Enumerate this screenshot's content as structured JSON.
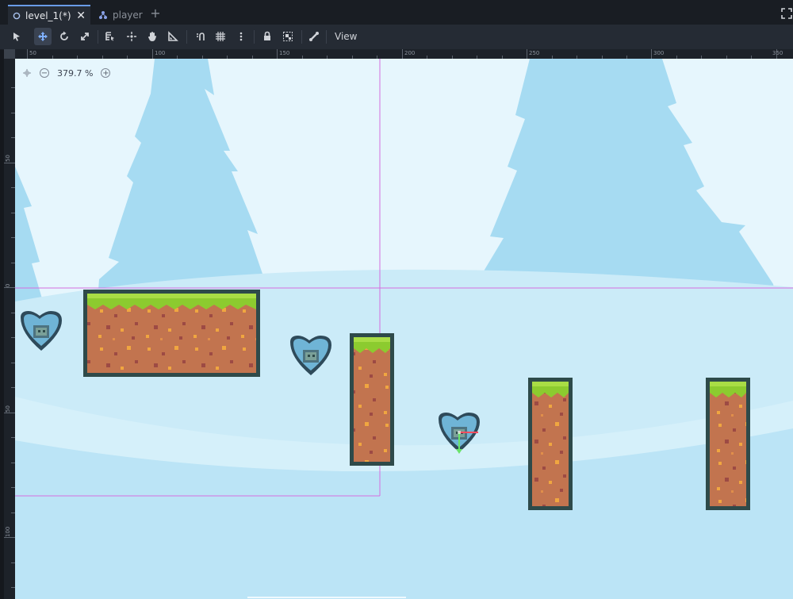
{
  "tabs": [
    {
      "label": "level_1(*)",
      "icon": "scene-circle-icon",
      "active": true
    },
    {
      "label": "player",
      "icon": "node-tree-icon",
      "active": false
    }
  ],
  "toolbar": {
    "view_label": "View",
    "tools": [
      "select-tool-icon",
      "move-tool-icon",
      "rotate-tool-icon",
      "scale-tool-icon",
      "list-select-icon",
      "pivot-icon",
      "pan-hand-icon",
      "ruler-icon",
      "smart-snap-icon",
      "grid-snap-icon",
      "more-options-icon",
      "lock-icon",
      "group-icon",
      "bone-icon"
    ]
  },
  "ruler": {
    "top_labels": [
      "50",
      "100",
      "150",
      "200",
      "250",
      "300",
      "350"
    ],
    "left_labels": [
      "50",
      "0",
      "50",
      "100"
    ]
  },
  "zoom": {
    "value": "379.7 %"
  },
  "colors": {
    "sky": "#bfe6f7",
    "tree": "#a6dbf2",
    "grass": "#8ccb2f",
    "dirt": "#c2744f",
    "outline": "#2e4a4a",
    "guide": "#d46ee0"
  }
}
